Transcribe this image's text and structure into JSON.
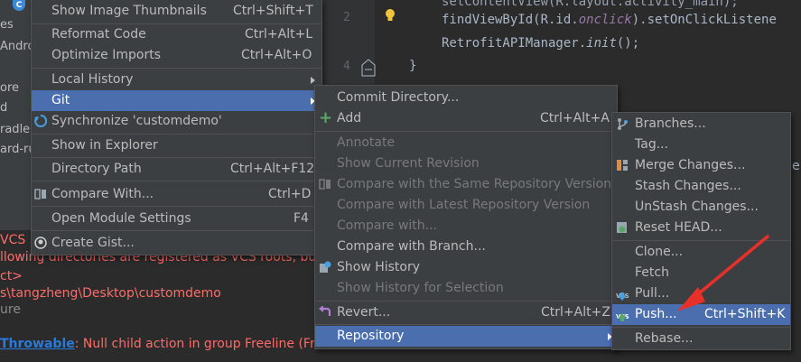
{
  "project_tree": {
    "top_icon": "C",
    "items": [
      "es",
      "Andro",
      "ore",
      "d",
      "radle",
      "ard-ru"
    ]
  },
  "editor": {
    "line_numbers": [
      "2",
      "4"
    ],
    "code_lines": [
      "findViewById(R.id.",
      "onclick",
      ").setOnClickListene",
      "RetrofitAPIManager.",
      "init",
      "();",
      "}"
    ],
    "right_fragment": "e"
  },
  "console": {
    "lines": [
      "VCS",
      "llowing directories are registered as VCS roots, but th",
      "ct>",
      "s\\tangzheng\\Desktop\\customdemo",
      "ure"
    ],
    "throwable_link": "Throwable",
    "throwable_text": ": Null child action in group Freeline (Freel"
  },
  "context_menu": {
    "items": [
      {
        "label": "Show Image Thumbnails",
        "shortcut": "Ctrl+Shift+T"
      },
      {
        "label": "Reformat Code",
        "shortcut": "Ctrl+Alt+L"
      },
      {
        "label": "Optimize Imports",
        "shortcut": "Ctrl+Alt+O"
      },
      {
        "label": "Local History"
      },
      {
        "label": "Git"
      },
      {
        "label": "Synchronize 'customdemo'"
      },
      {
        "label": "Show in Explorer"
      },
      {
        "label": "Directory Path",
        "shortcut": "Ctrl+Alt+F12"
      },
      {
        "label": "Compare With...",
        "shortcut": "Ctrl+D"
      },
      {
        "label": "Open Module Settings",
        "shortcut": "F4"
      },
      {
        "label": "Create Gist..."
      }
    ]
  },
  "git_menu": {
    "items": [
      {
        "label": "Commit Directory..."
      },
      {
        "label": "Add",
        "shortcut": "Ctrl+Alt+A"
      },
      {
        "label": "Annotate"
      },
      {
        "label": "Show Current Revision"
      },
      {
        "label": "Compare with the Same Repository Version"
      },
      {
        "label": "Compare with Latest Repository Version"
      },
      {
        "label": "Compare with..."
      },
      {
        "label": "Compare with Branch..."
      },
      {
        "label": "Show History"
      },
      {
        "label": "Show History for Selection"
      },
      {
        "label": "Revert...",
        "shortcut": "Ctrl+Alt+Z"
      },
      {
        "label": "Repository"
      }
    ]
  },
  "repository_menu": {
    "items": [
      {
        "label": "Branches..."
      },
      {
        "label": "Tag..."
      },
      {
        "label": "Merge Changes..."
      },
      {
        "label": "Stash Changes..."
      },
      {
        "label": "UnStash Changes..."
      },
      {
        "label": "Reset HEAD..."
      },
      {
        "label": "Clone..."
      },
      {
        "label": "Fetch"
      },
      {
        "label": "Pull..."
      },
      {
        "label": "Push...",
        "shortcut": "Ctrl+Shift+K"
      },
      {
        "label": "Rebase..."
      }
    ],
    "vcs_badge": "VCS"
  },
  "colors": {
    "menu_bg": "#3c3f41",
    "selection": "#4b6eaf",
    "disabled_text": "#77797b",
    "console_error": "#ff6b68",
    "link": "#287bde",
    "annotation_arrow": "#e8302a",
    "add_icon": "#59a869"
  }
}
